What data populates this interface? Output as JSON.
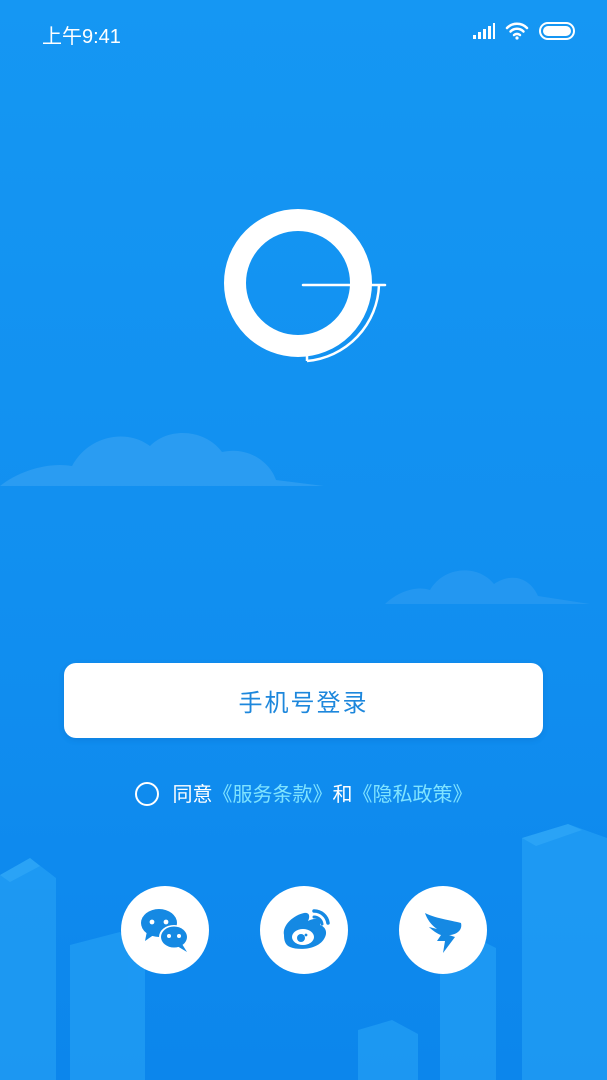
{
  "status_bar": {
    "time": "上午9:41",
    "icons": [
      "signal-icon",
      "wifi-icon",
      "battery-icon"
    ]
  },
  "logo": {
    "icon": "app-logo-icon"
  },
  "login": {
    "phone_login_label": "手机号登录"
  },
  "agreement": {
    "agree_text": "同意",
    "terms_link": "《服务条款》",
    "and_text": "和",
    "privacy_link": "《隐私政策》",
    "checked": false
  },
  "social_logins": [
    {
      "icon": "wechat-icon"
    },
    {
      "icon": "weibo-icon"
    },
    {
      "icon": "dingtalk-icon"
    }
  ],
  "colors": {
    "background": "#1597f3",
    "button_text": "#1d87dc",
    "link": "#7fe3ff",
    "white": "#ffffff"
  }
}
